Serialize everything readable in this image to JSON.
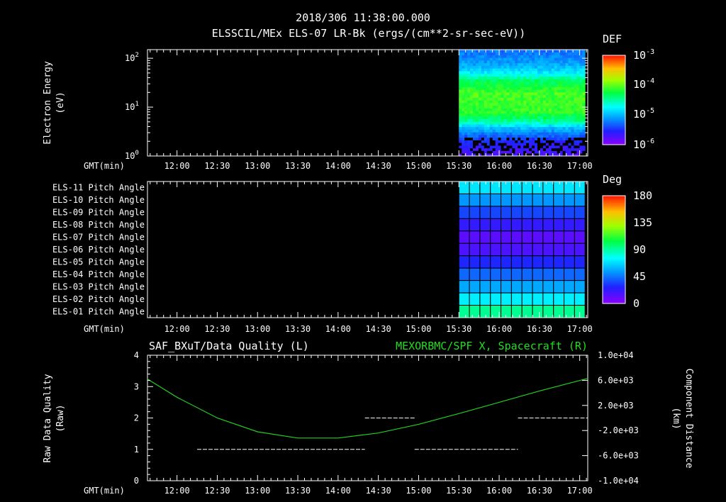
{
  "header": {
    "timestamp": "2018/306 11:38:00.000",
    "subtitle": "ELSSCIL/MEx ELS-07 LR-Bk  (ergs/(cm**2-sr-sec-eV))"
  },
  "time_axis": {
    "label": "GMT(min)",
    "ticks": [
      "12:00",
      "12:30",
      "13:00",
      "13:30",
      "14:00",
      "14:30",
      "15:00",
      "15:30",
      "16:00",
      "16:30",
      "17:00"
    ],
    "xlim": [
      "11:38",
      "17:06"
    ]
  },
  "colors": {
    "background": "#000000",
    "axes": "#ffffff",
    "component_line": "#22cc22",
    "right_title": "#22dd22"
  },
  "chart_data": [
    {
      "type": "heatmap",
      "ylabel": "Electron Energy",
      "yunit": "(eV)",
      "yscale": "log",
      "ylim": [
        1,
        150
      ],
      "yticks": [
        {
          "value": 1,
          "base": "10",
          "exp": "0"
        },
        {
          "value": 10,
          "base": "10",
          "exp": "1"
        },
        {
          "value": 100,
          "base": "10",
          "exp": "2"
        }
      ],
      "data_start": "15:30",
      "data_end": "17:04",
      "colorbar": {
        "title": "DEF",
        "ticks": [
          {
            "base": "10",
            "exp": "-3"
          },
          {
            "base": "10",
            "exp": "-4"
          },
          {
            "base": "10",
            "exp": "-5"
          },
          {
            "base": "10",
            "exp": "-6"
          }
        ]
      },
      "energy_profile": [
        {
          "energy": 1.0,
          "level": 0.08
        },
        {
          "energy": 2.0,
          "level": 0.15
        },
        {
          "energy": 3.0,
          "level": 0.27
        },
        {
          "energy": 4.0,
          "level": 0.36
        },
        {
          "energy": 5.0,
          "level": 0.5
        },
        {
          "energy": 8.0,
          "level": 0.62
        },
        {
          "energy": 20.0,
          "level": 0.64
        },
        {
          "energy": 35.0,
          "level": 0.55
        },
        {
          "energy": 50.0,
          "level": 0.4
        },
        {
          "energy": 80.0,
          "level": 0.3
        },
        {
          "energy": 150.0,
          "level": 0.24
        }
      ]
    },
    {
      "type": "heatmap",
      "rows": [
        "ELS-11 Pitch Angle",
        "ELS-10 Pitch Angle",
        "ELS-09 Pitch Angle",
        "ELS-08 Pitch Angle",
        "ELS-07 Pitch Angle",
        "ELS-06 Pitch Angle",
        "ELS-05 Pitch Angle",
        "ELS-04 Pitch Angle",
        "ELS-03 Pitch Angle",
        "ELS-02 Pitch Angle",
        "ELS-01 Pitch Angle"
      ],
      "pitch_angle_deg": [
        70,
        52,
        35,
        22,
        12,
        16,
        28,
        42,
        56,
        72,
        92
      ],
      "data_start": "15:30",
      "data_end": "17:04",
      "grid_columns": 12,
      "colorbar": {
        "title": "Deg",
        "range": [
          0,
          180
        ],
        "ticks": [
          "180",
          "135",
          "90",
          "45",
          "0"
        ]
      }
    },
    {
      "type": "line",
      "left_title": "SAF_BXuT/Data Quality (L)",
      "right_title": "MEXORBMC/SPF X, Spacecraft (R)",
      "ylabel_left": "Raw Data Quality",
      "ylabel_left_unit": "(Raw)",
      "ylabel_right": "Component Distance",
      "ylabel_right_unit": "(km)",
      "ylim_left": [
        0,
        4
      ],
      "left_ticks": [
        "0",
        "1",
        "2",
        "3",
        "4"
      ],
      "ylim_right": [
        -10000,
        10000
      ],
      "right_ticks": [
        "-1.0e+04",
        "-6.0e+03",
        "-2.0e+03",
        "2.0e+03",
        "6.0e+03",
        "1.0e+04"
      ],
      "series": [
        {
          "role": "data_quality",
          "segments": [
            {
              "start": "11:43",
              "end": "12:15",
              "value": 0
            },
            {
              "start": "12:15",
              "end": "14:20",
              "value": 1
            },
            {
              "start": "14:20",
              "end": "14:57",
              "value": 2
            },
            {
              "start": "14:57",
              "end": "16:14",
              "value": 1
            },
            {
              "start": "16:14",
              "end": "17:06",
              "value": 2
            }
          ]
        },
        {
          "role": "spacecraft_x",
          "points": [
            {
              "t": "11:38",
              "km": 6200
            },
            {
              "t": "12:00",
              "km": 3300
            },
            {
              "t": "12:30",
              "km": 0
            },
            {
              "t": "13:00",
              "km": -2200
            },
            {
              "t": "13:30",
              "km": -3200
            },
            {
              "t": "14:00",
              "km": -3200
            },
            {
              "t": "14:30",
              "km": -2400
            },
            {
              "t": "15:00",
              "km": -1000
            },
            {
              "t": "15:30",
              "km": 700
            },
            {
              "t": "16:00",
              "km": 2500
            },
            {
              "t": "16:30",
              "km": 4300
            },
            {
              "t": "17:06",
              "km": 6300
            }
          ]
        }
      ]
    }
  ]
}
